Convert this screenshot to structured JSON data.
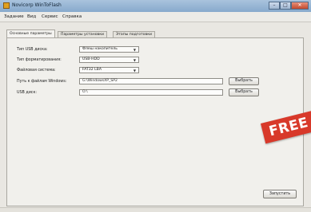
{
  "window": {
    "title": "Novicorp WinToFlash",
    "caption_buttons": [
      "minimize",
      "maximize",
      "close"
    ]
  },
  "menu": [
    "Задание",
    "Вид",
    "Сервис",
    "Справка"
  ],
  "tabs": [
    {
      "label": "Основные параметры",
      "active": true
    },
    {
      "label": "Параметры установки",
      "active": false
    },
    {
      "label": "Этапы подготовки",
      "active": false
    }
  ],
  "form": {
    "usb_type": {
      "label": "Тип USB диска:",
      "value": "Флеш накопитель"
    },
    "format_type": {
      "label": "Тип форматирования:",
      "value": "USB-HDD"
    },
    "filesystem": {
      "label": "Файловая система:",
      "value": "FAT32 LBA"
    },
    "windows_path": {
      "label": "Путь к файлам Windows:",
      "value": "G:\\WindowsXP_SP2",
      "button": "Выбрать"
    },
    "usb_disk": {
      "label": "USB диск:",
      "value": "O:\\",
      "button": "Выбрать"
    }
  },
  "run_button": "Запустить",
  "overlay_badge": "FREE",
  "colors": {
    "badge": "#d8392a",
    "titlebar": "#9bb7d6",
    "close_button": "#c24a2e"
  }
}
